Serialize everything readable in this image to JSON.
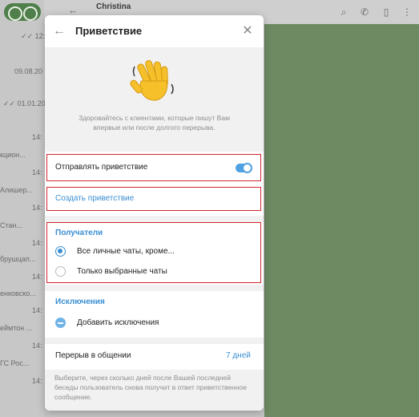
{
  "background": {
    "chat_title": "Christina",
    "list": [
      {
        "time": "12:",
        "check": true
      },
      {
        "time": "09.08.20",
        "check": false
      },
      {
        "time": "01.01.20",
        "check": true
      },
      {
        "time": "14:",
        "check": false
      },
      {
        "time": "кцион...",
        "check": false
      },
      {
        "time": "14:",
        "check": false
      },
      {
        "time": "Алишер...",
        "check": false
      },
      {
        "time": "14:",
        "check": false
      },
      {
        "time": "Стан...",
        "check": false
      },
      {
        "time": "14:",
        "check": false
      },
      {
        "time": "брушцап...",
        "check": false
      },
      {
        "time": "14:",
        "check": false
      },
      {
        "time": "енковско...",
        "check": false
      },
      {
        "time": "14:",
        "check": false
      },
      {
        "time": "еймтон ...",
        "check": false
      },
      {
        "time": "14:",
        "check": false
      },
      {
        "time": "ГС Рос...",
        "check": false
      },
      {
        "time": "14:",
        "check": false
      }
    ]
  },
  "modal": {
    "title": "Приветствие",
    "hero_text": "Здоровайтесь с клиентами, которые пишут Вам впервые или после долгого перерыва.",
    "send_greeting_label": "Отправлять приветствие",
    "send_greeting_enabled": true,
    "create_greeting_label": "Создать приветствие",
    "recipients_header": "Получатели",
    "recipients_options": [
      {
        "label": "Все личные чаты, кроме...",
        "selected": true
      },
      {
        "label": "Только выбранные чаты",
        "selected": false
      }
    ],
    "exceptions_header": "Исключения",
    "add_exception_label": "Добавить исключения",
    "pause_label": "Перерыв в общении",
    "pause_value": "7 дней",
    "footer_text": "Выберите, через сколько дней после Вашей последней беседы пользователь снова получит в ответ приветственное сообщение."
  },
  "colors": {
    "accent": "#3a8ed2",
    "highlight_border": "#d0272e",
    "toggle_on": "#4fa1e0"
  }
}
